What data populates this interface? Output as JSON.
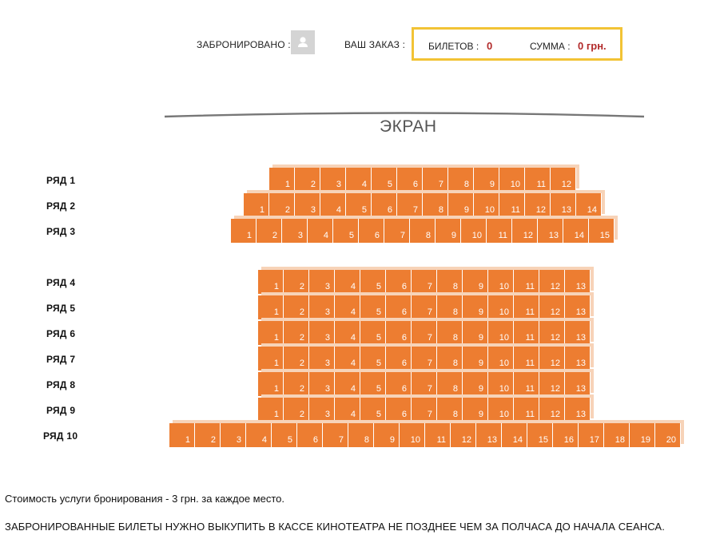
{
  "header": {
    "booked_label": "ЗАБРОНИРОВАНО :",
    "order_label": "ВАШ ЗАКАЗ :",
    "tickets_label": "БИЛЕТОВ :",
    "tickets_value": "0",
    "sum_label": "СУММА :",
    "sum_value": "0 грн."
  },
  "screen_label": "ЭКРАН",
  "rows": [
    {
      "label": "РЯД 1",
      "seats": 12
    },
    {
      "label": "РЯД 2",
      "seats": 14
    },
    {
      "label": "РЯД 3",
      "seats": 15
    },
    {
      "label": "РЯД 4",
      "seats": 13
    },
    {
      "label": "РЯД 5",
      "seats": 13
    },
    {
      "label": "РЯД 6",
      "seats": 13
    },
    {
      "label": "РЯД 7",
      "seats": 13
    },
    {
      "label": "РЯД 8",
      "seats": 13
    },
    {
      "label": "РЯД 9",
      "seats": 13
    },
    {
      "label": "РЯД 10",
      "seats": 20
    }
  ],
  "notes": {
    "fee": "Стоимость услуги бронирования - 3 грн. за каждое место.",
    "warning": "ЗАБРОНИРОВАННЫЕ БИЛЕТЫ НУЖНО ВЫКУПИТЬ В КАССЕ КИНОТЕАТРА НЕ ПОЗДНЕЕ ЧЕМ ЗА ПОЛЧАСА ДО НАЧАЛА СЕАНСА."
  },
  "colors": {
    "seat": "#ed7d31",
    "seat_shadow": "#f7d3b8",
    "order_border": "#f2c335",
    "value_red": "#b22a2a"
  }
}
